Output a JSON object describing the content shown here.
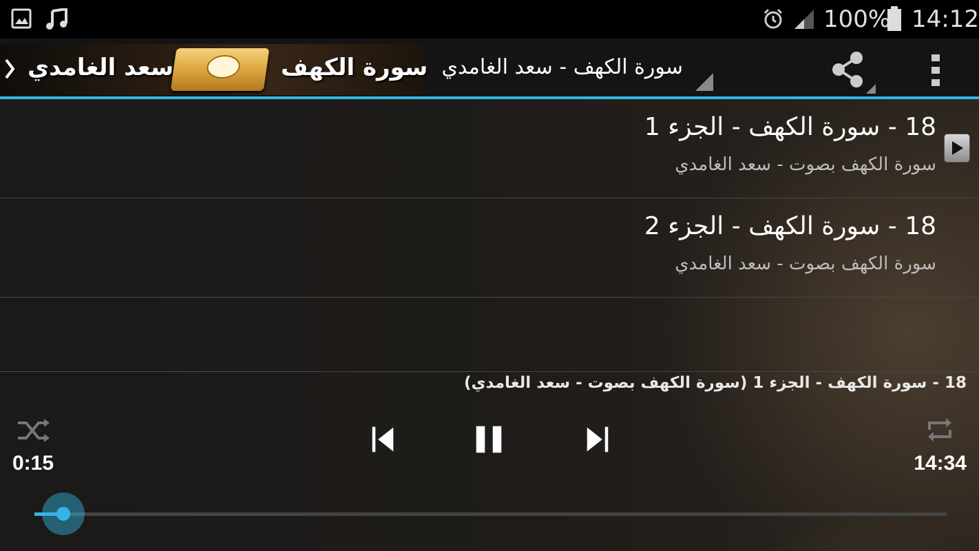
{
  "status_bar": {
    "battery_text": "100%",
    "clock": "14:12",
    "icons": [
      "image-icon",
      "music-note-icon",
      "alarm-icon",
      "signal-icon",
      "battery-icon"
    ]
  },
  "action_bar": {
    "banner_surah": "سورة الكهف",
    "banner_reciter": "سعد الغامدي",
    "title": "سورة الكهف - سعد الغامدي",
    "icons": [
      "chevron-right-icon",
      "share-icon",
      "overflow-menu-icon"
    ]
  },
  "tracks": [
    {
      "title": "18 - سورة الكهف - الجزء 1",
      "subtitle": "سورة الكهف بصوت - سعد الغامدي",
      "playing": true
    },
    {
      "title": "18 - سورة الكهف - الجزء 2",
      "subtitle": "سورة الكهف بصوت - سعد الغامدي",
      "playing": false
    }
  ],
  "player": {
    "now_playing": "18 - سورة الكهف - الجزء 1 (سورة الكهف بصوت - سعد الغامدي)",
    "elapsed": "0:15",
    "duration": "14:34",
    "progress_fraction": 0.017,
    "accent_color": "#33b5e5"
  }
}
